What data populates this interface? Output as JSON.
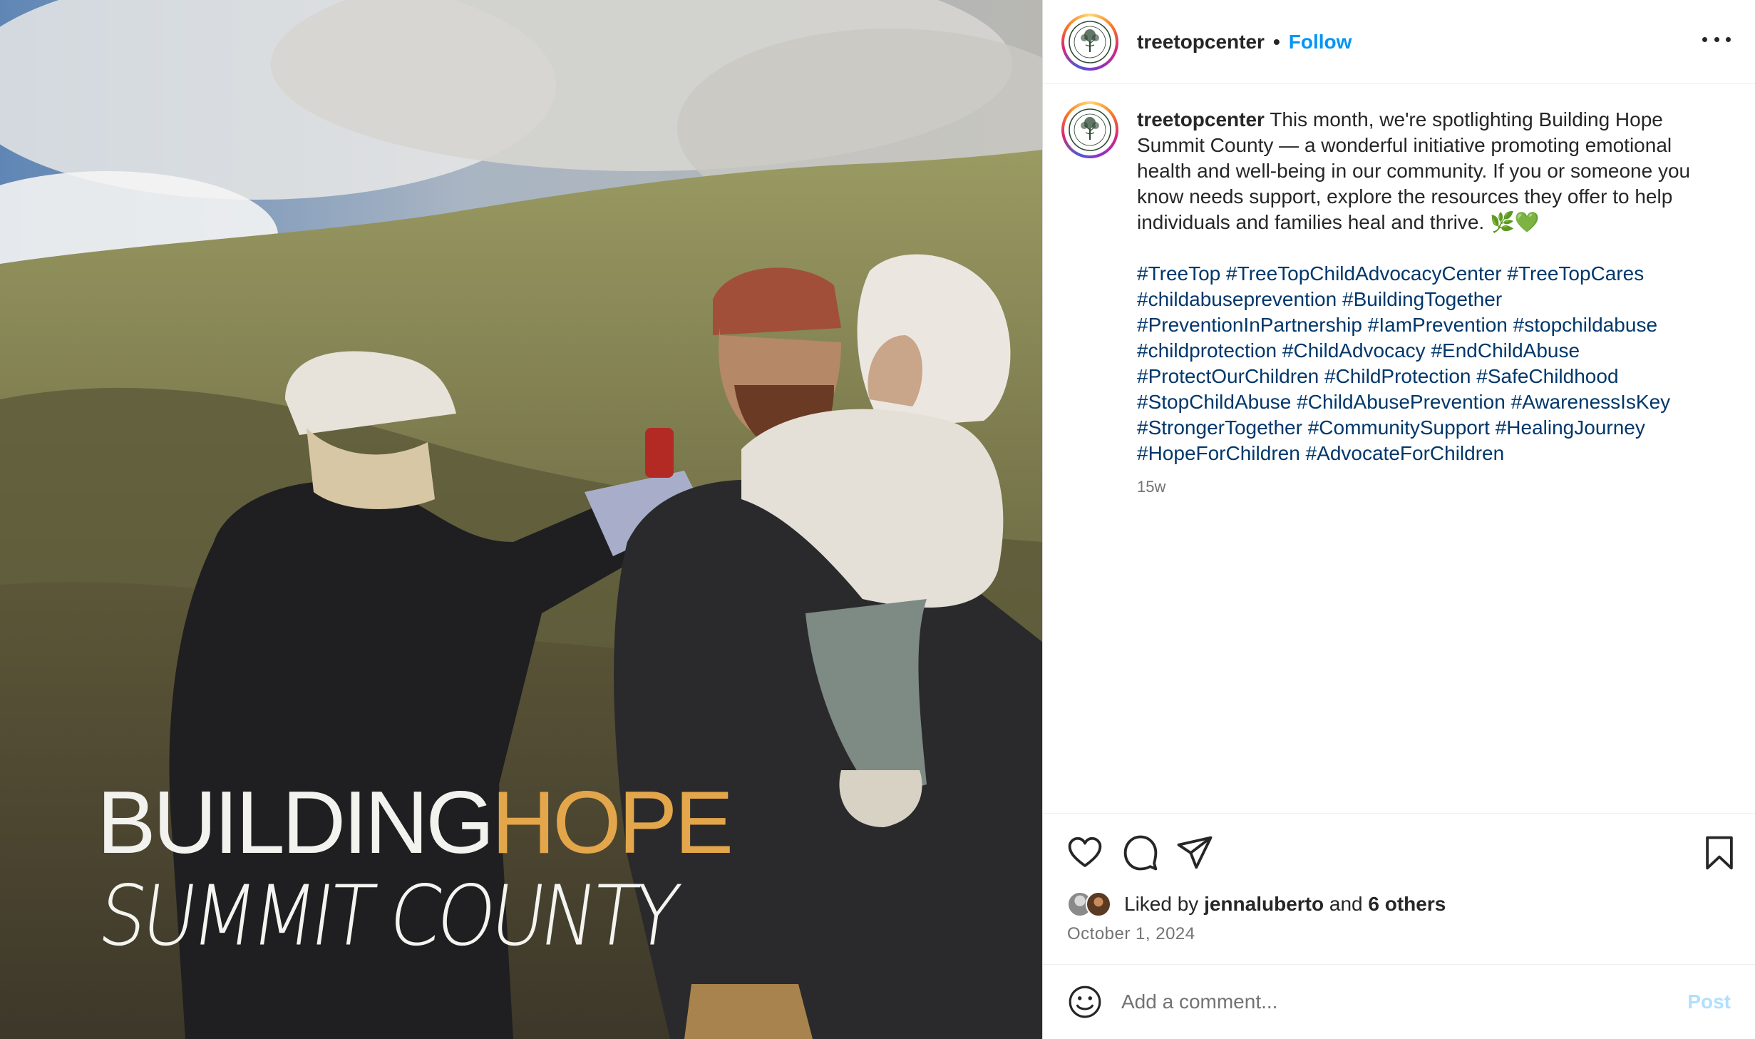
{
  "photo": {
    "overlay_line1_white": "BUILDING",
    "overlay_line1_orange": "HOPE",
    "overlay_line2": "SUMMIT COUNTY",
    "colors": {
      "overlay_white": "#f2f2ee",
      "overlay_orange": "#e3a64a"
    }
  },
  "header": {
    "username": "treetopcenter",
    "separator": "•",
    "follow_label": "Follow",
    "avatar_icon": "treetop-logo-icon",
    "more_icon": "more-options-icon"
  },
  "caption": {
    "username": "treetopcenter",
    "text": "This month, we're spotlighting Building Hope Summit County — a wonderful initiative promoting emotional health and well-being in our community. If you or someone you know needs support, explore the resources they offer to help individuals and families heal and thrive. 🌿💚",
    "hashtag_lines": [
      [
        "#TreeTop",
        "#TreeTopChildAdvocacyCenter",
        "#TreeTopCares"
      ],
      [
        "#childabuseprevention",
        "#BuildingTogether"
      ],
      [
        "#PreventionInPartnership",
        "#IamPrevention",
        "#stopchildabuse"
      ],
      [
        "#childprotection",
        "#ChildAdvocacy",
        "#EndChildAbuse"
      ],
      [
        "#ProtectOurChildren",
        "#ChildProtection",
        "#SafeChildhood"
      ],
      [
        "#StopChildAbuse",
        "#ChildAbusePrevention",
        "#AwarenessIsKey"
      ],
      [
        "#StrongerTogether",
        "#CommunitySupport",
        "#HealingJourney"
      ],
      [
        "#HopeForChildren",
        "#AdvocateForChildren"
      ]
    ],
    "time_ago": "15w"
  },
  "actions": {
    "like_icon": "heart-icon",
    "comment_icon": "comment-icon",
    "share_icon": "share-icon",
    "save_icon": "bookmark-icon"
  },
  "likes": {
    "prefix": "Liked by",
    "user": "jennaluberto",
    "conjunction": "and",
    "others": "6 others"
  },
  "date": "October 1, 2024",
  "comment": {
    "placeholder": "Add a comment...",
    "post_label": "Post",
    "emoji_icon": "emoji-icon"
  },
  "colors": {
    "link_blue": "#0095f6",
    "hashtag_blue": "#00376b",
    "post_disabled": "#b2dffc",
    "secondary_text": "#737373"
  }
}
